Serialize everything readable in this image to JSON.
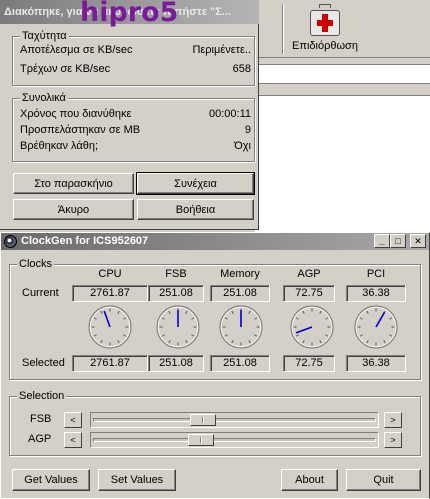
{
  "background_app": {
    "toolbar_button_label": "Επιδιόρθωση",
    "toolbar_button_icon": "first-aid-kit-icon"
  },
  "progress_dialog": {
    "title": "Διακόπηκε, για να ακυρώσετε πατήστε \"Σ...",
    "logo_text": "hipro5",
    "speed_group": {
      "label": "Ταχύτητα",
      "rows": [
        {
          "label": "Αποτέλεσμα σε KB/sec",
          "value": "Περιμένετε.."
        },
        {
          "label": "Τρέχων σε KB/sec",
          "value": "658"
        }
      ]
    },
    "totals_group": {
      "label": "Συνολικά",
      "rows": [
        {
          "label": "Χρόνος που διανύθηκε",
          "value": "00:00:11"
        },
        {
          "label": "Προσπελάστηκαν σε MB",
          "value": "9"
        },
        {
          "label": "Βρέθηκαν λάθη;",
          "value": "Όχι"
        }
      ]
    },
    "buttons": {
      "background": "Στο παρασκήνιο",
      "continue": "Συνέχεια",
      "cancel": "Άκυρο",
      "help": "Βοήθεια"
    }
  },
  "clockgen": {
    "title": "ClockGen for ICS952607",
    "title_buttons": {
      "minimize": "_",
      "maximize": "□",
      "close": "✕"
    },
    "clocks_group": {
      "label": "Clocks",
      "columns": [
        "CPU",
        "FSB",
        "Memory",
        "AGP",
        "PCI"
      ],
      "current_label": "Current",
      "selected_label": "Selected",
      "current": [
        "2761.87",
        "251.08",
        "251.08",
        "72.75",
        "36.38"
      ],
      "selected": [
        "2761.87",
        "251.08",
        "251.08",
        "72.75",
        "36.38"
      ],
      "dial_hand_angles_deg": [
        -20,
        0,
        0,
        250,
        30
      ]
    },
    "selection_group": {
      "label": "Selection",
      "sliders": [
        {
          "label": "FSB",
          "position": 0.38,
          "left_arrow": "<",
          "right_arrow": ">"
        },
        {
          "label": "AGP",
          "position": 0.37,
          "left_arrow": "<",
          "right_arrow": ">"
        }
      ]
    },
    "buttons": {
      "get_values": "Get Values",
      "set_values": "Set Values",
      "about": "About",
      "quit": "Quit"
    },
    "dial_hand_color": "#0000cc"
  }
}
